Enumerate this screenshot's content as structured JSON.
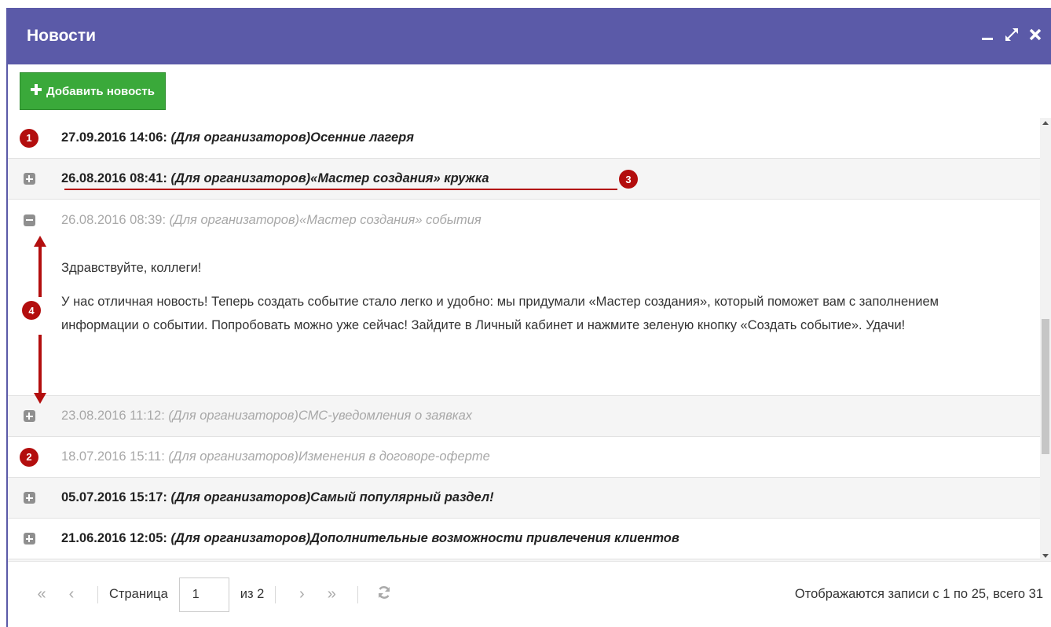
{
  "window": {
    "title": "Новости",
    "controls": [
      "minimize-icon",
      "maximize-icon",
      "close-icon"
    ]
  },
  "toolbar": {
    "add_label": "Добавить новость",
    "add_icon": "plus-icon"
  },
  "news": [
    {
      "date": "27.09.2016 14:06:",
      "subject": "(Для организаторов)Осенние лагеря",
      "read": false,
      "badge": "1"
    },
    {
      "date": "26.08.2016 08:41:",
      "subject": "(Для организаторов)«Мастер создания» кружка",
      "read": false,
      "badge": "3"
    },
    {
      "date": "26.08.2016 08:39:",
      "subject": "(Для организаторов)«Мастер создания» события",
      "read": true,
      "expanded": true,
      "body": {
        "greeting": "Здравствуйте, коллеги!",
        "text": "У нас отличная новость! Теперь создать событие стало легко и удобно: мы придумали «Мастер создания», который поможет вам с заполнением информации о событии. Попробовать можно уже сейчас! Зайдите в Личный кабинет и нажмите зеленую кнопку «Создать событие». Удачи!"
      },
      "badge": "4"
    },
    {
      "date": "23.08.2016 11:12:",
      "subject": "(Для организаторов)СМС-уведомления о заявках",
      "read": true
    },
    {
      "date": "18.07.2016 15:11:",
      "subject": "(Для организаторов)Изменения в договоре-оферте",
      "read": true,
      "badge": "2"
    },
    {
      "date": "05.07.2016 15:17:",
      "subject": "(Для организаторов)Самый популярный раздел!",
      "read": false
    },
    {
      "date": "21.06.2016 12:05:",
      "subject": "(Для организаторов)Дополнительные возможности привлечения клиентов",
      "read": false
    }
  ],
  "pager": {
    "page_label": "Страница",
    "page_value": "1",
    "of_label": "из 2",
    "status": "Отображаются записи с 1 по 25, всего 31"
  },
  "colors": {
    "header": "#5b5aa8",
    "add_button": "#3aa93a",
    "annotation": "#b30e0e"
  }
}
